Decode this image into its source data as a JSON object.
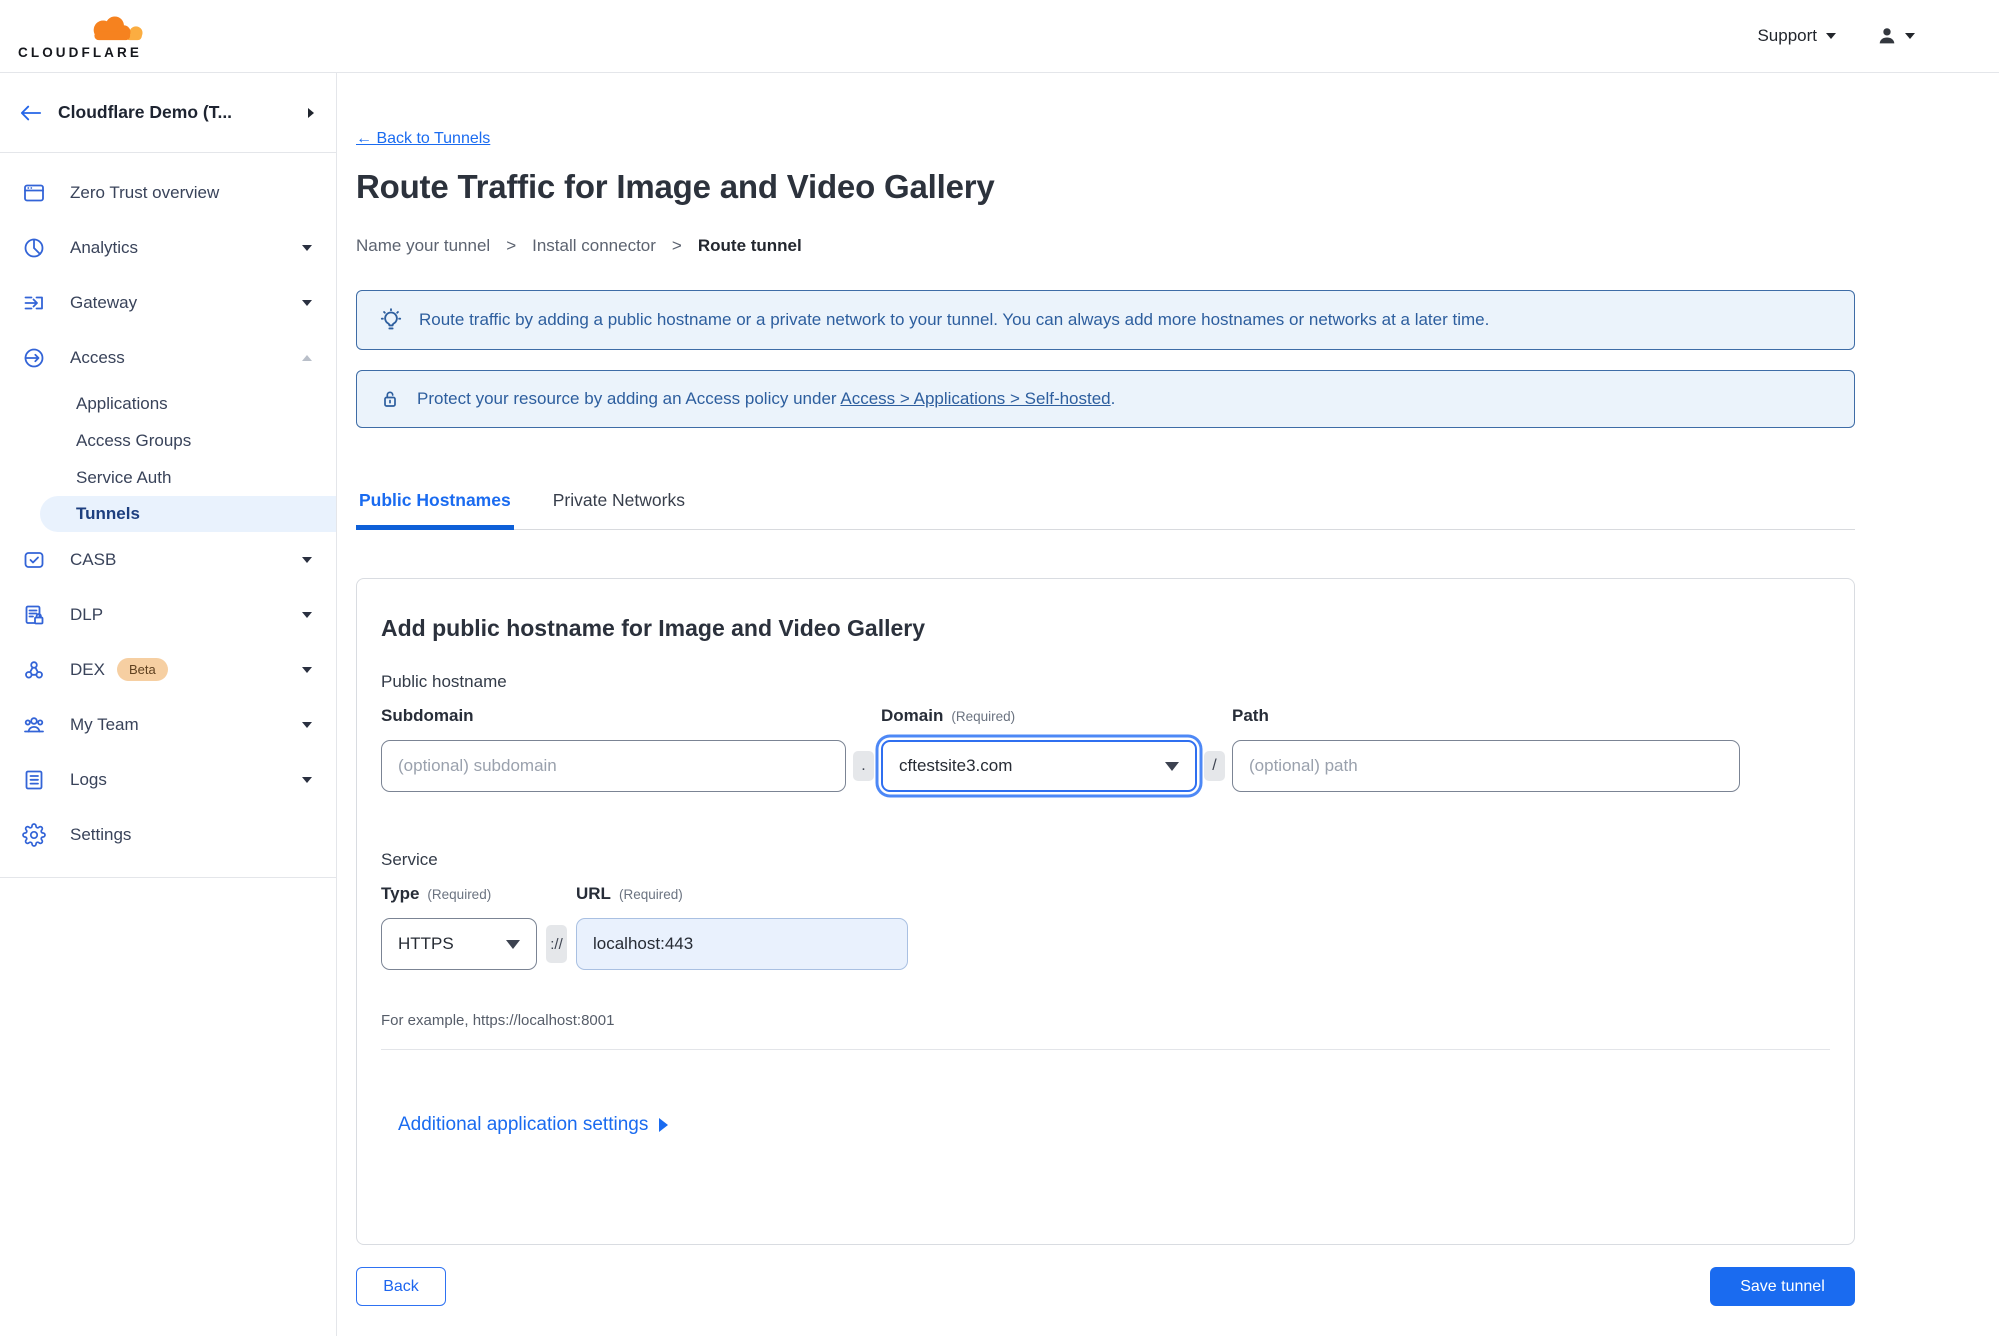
{
  "header": {
    "logo_text": "CLOUDFLARE",
    "support_label": "Support"
  },
  "colors": {
    "accent": "#1a6bf0",
    "link": "#1a6bf0",
    "banner-bg": "#ebf3fb",
    "banner-border": "#3e6ca6",
    "banner-text": "#2d5e9e",
    "sidebar-icon": "#3364d7",
    "selected-bg": "#e9f2fd",
    "selected-text": "#1d3f7f",
    "beta-bg": "#f6cfa2",
    "beta-text": "#5f4120",
    "url-bg": "#e9f1fd",
    "brand-orange": "#f6821f",
    "brand-orange-light": "#fbad41"
  },
  "sidebar": {
    "team_name": "Cloudflare Demo (T...",
    "items": [
      {
        "label": "Zero Trust overview"
      },
      {
        "label": "Analytics"
      },
      {
        "label": "Gateway"
      },
      {
        "label": "Access"
      },
      {
        "label": "CASB"
      },
      {
        "label": "DLP"
      },
      {
        "label": "DEX",
        "badge": "Beta"
      },
      {
        "label": "My Team"
      },
      {
        "label": "Logs"
      },
      {
        "label": "Settings"
      }
    ],
    "access_children": [
      "Applications",
      "Access Groups",
      "Service Auth",
      "Tunnels"
    ],
    "selected_item": "Tunnels"
  },
  "main": {
    "back_link": {
      "arrow": "←",
      "label": "Back to Tunnels"
    },
    "title": "Route Traffic for Image and Video Gallery",
    "breadcrumb": {
      "step1": "Name your tunnel",
      "step2": "Install connector",
      "step3": "Route tunnel",
      "separator": ">"
    },
    "banner_info": {
      "text": "Route traffic by adding a public hostname or a private network to your tunnel. You can always add more hostnames or networks at a later time."
    },
    "banner_access": {
      "text_before": "Protect your resource by adding an Access policy under",
      "link_text": "Access > Applications > Self-hosted",
      "text_after": "."
    },
    "tabs": {
      "public": "Public Hostnames",
      "private": "Private Networks"
    },
    "card": {
      "heading": "Add public hostname for Image and Video Gallery",
      "public_hostname_label": "Public hostname",
      "subdomain_label": "Subdomain",
      "subdomain_placeholder": "(optional) subdomain",
      "dot": ".",
      "domain_label": "Domain",
      "required_hint": "(Required)",
      "domain_value": "cftestsite3.com",
      "slash": "/",
      "path_label": "Path",
      "path_placeholder": "(optional) path",
      "service_label": "Service",
      "type_label": "Type",
      "type_value": "HTTPS",
      "scheme_sep": "://",
      "url_label": "URL",
      "url_value": "localhost:443",
      "example_hint": "For example, https://localhost:8001",
      "additional_settings_label": "Additional application settings"
    },
    "footer": {
      "back_label": "Back",
      "save_label": "Save tunnel"
    }
  }
}
